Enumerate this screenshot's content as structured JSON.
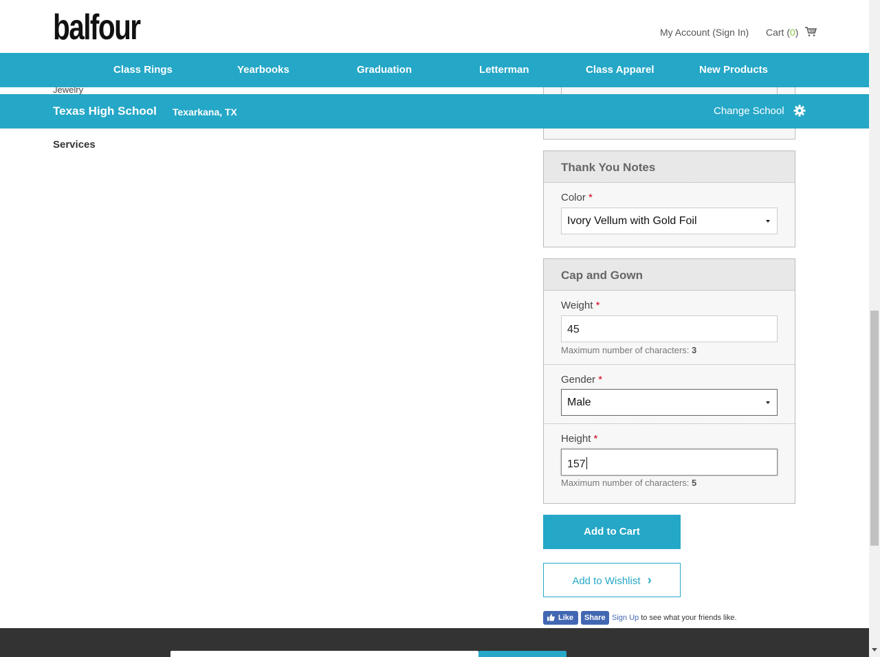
{
  "header": {
    "logo": "balfour",
    "account_link": "My Account (Sign In)",
    "cart_label": "Cart (",
    "cart_count": "0",
    "cart_close": ")"
  },
  "main_nav": [
    "Class Rings",
    "Yearbooks",
    "Graduation",
    "Letterman",
    "Class Apparel",
    "New Products"
  ],
  "left_nav": {
    "jewelry": "Jewelry",
    "services": "Services"
  },
  "school": {
    "name": "Texas High School",
    "location": "Texarkana, TX",
    "change_label": "Change School"
  },
  "thank_you_notes": {
    "title": "Thank You Notes",
    "color_label": "Color",
    "required_mark": "*",
    "color_value": "Ivory Vellum with Gold Foil"
  },
  "cap_and_gown": {
    "title": "Cap and Gown",
    "weight_label": "Weight",
    "weight_value": "45",
    "weight_hint": "Maximum number of characters:",
    "weight_max": "3",
    "gender_label": "Gender",
    "gender_value": "Male",
    "height_label": "Height",
    "height_value": "157",
    "height_hint": "Maximum number of characters:",
    "height_max": "5"
  },
  "actions": {
    "add_to_cart": "Add to Cart",
    "add_to_wishlist": "Add to Wishlist",
    "wishlist_arrow": "›"
  },
  "facebook": {
    "like": "Like",
    "share": "Share",
    "signup": "Sign Up",
    "signup_rest": " to see what your friends like."
  },
  "colors": {
    "brand_teal": "#25a7c7",
    "cart_count_green": "#8cc63f",
    "required_red": "#d0021b",
    "facebook_blue": "#4267b2"
  }
}
